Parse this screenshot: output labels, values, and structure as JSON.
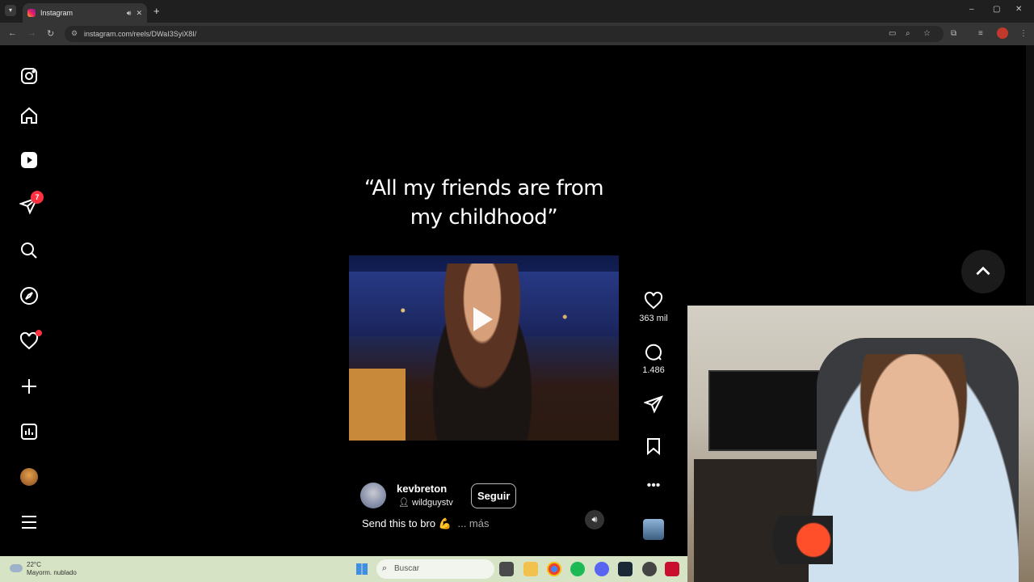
{
  "browser": {
    "tab_title": "Instagram",
    "tab_audio_icon": "speaker-icon",
    "tab_close": "✕",
    "new_tab": "+",
    "url": "instagram.com/reels/DWaI3SyiX8I/",
    "window_controls": [
      "–",
      "▢",
      "✕"
    ]
  },
  "sidebar": {
    "items": [
      {
        "name": "instagram-logo-icon"
      },
      {
        "name": "home-icon"
      },
      {
        "name": "reels-icon"
      },
      {
        "name": "messages-icon",
        "badge": "7"
      },
      {
        "name": "search-icon"
      },
      {
        "name": "explore-icon"
      },
      {
        "name": "notifications-icon",
        "dot": true
      },
      {
        "name": "create-icon"
      },
      {
        "name": "dashboard-icon"
      },
      {
        "name": "profile-avatar"
      },
      {
        "name": "more-menu-icon"
      }
    ]
  },
  "reel": {
    "quote_line1": "“All my friends are from",
    "quote_line2": "my childhood”",
    "username": "kevbreton",
    "audio": "wildguystv",
    "follow_label": "Seguir",
    "caption": "Send this to bro 💪",
    "more_label": "... más",
    "likes": "363 mil",
    "comments": "1.486"
  },
  "taskbar": {
    "temperature": "22°C",
    "weather": "Mayorm. nublado",
    "search_placeholder": "Buscar"
  },
  "colors": {
    "accent": "#ff3040",
    "background": "#000000",
    "taskbar": "#d6e3c4"
  }
}
